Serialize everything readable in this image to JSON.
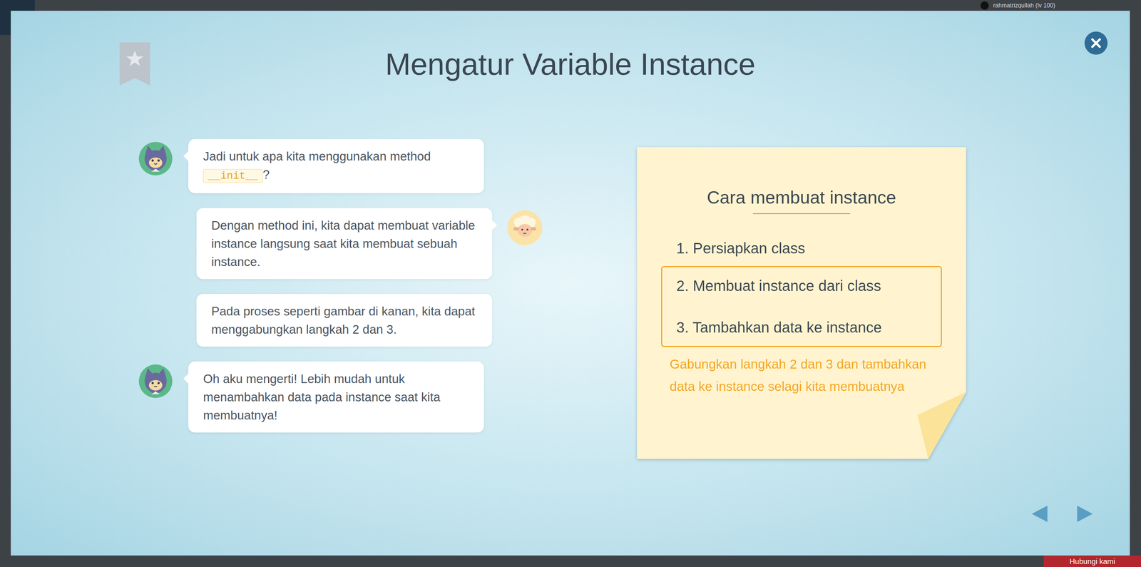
{
  "background": {
    "user": "rahmatrizqullah (lv 100)",
    "help_button": "Hubungi kami"
  },
  "dialog": {
    "title": "Mengatur Variable Instance",
    "bookmarked": false
  },
  "messages": [
    {
      "speaker": "cat",
      "side": "left",
      "show_avatar": true,
      "segments": [
        {
          "text": "Jadi untuk apa kita menggunakan method ",
          "code": false
        },
        {
          "text": "__init__",
          "code": true
        },
        {
          "text": "?",
          "code": false
        }
      ]
    },
    {
      "speaker": "sheep",
      "side": "right",
      "show_avatar": true,
      "segments": [
        {
          "text": "Dengan method ini, kita dapat membuat variable instance langsung saat kita membuat sebuah instance.",
          "code": false
        }
      ]
    },
    {
      "speaker": "sheep",
      "side": "right",
      "show_avatar": false,
      "segments": [
        {
          "text": "Pada proses seperti gambar di kanan, kita dapat menggabungkan langkah 2 dan 3.",
          "code": false
        }
      ]
    },
    {
      "speaker": "cat",
      "side": "left",
      "show_avatar": true,
      "segments": [
        {
          "text": "Oh aku mengerti! Lebih mudah untuk menambahkan data pada instance saat kita membuatnya!",
          "code": false
        }
      ]
    }
  ],
  "note": {
    "title": "Cara membuat instance",
    "steps": [
      {
        "text": "1. Persiapkan class",
        "highlighted": false
      },
      {
        "text": "2. Membuat instance dari class",
        "highlighted": true
      },
      {
        "text": "3. Tambahkan data ke instance",
        "highlighted": true
      }
    ],
    "hint": "Gabungkan langkah 2 dan 3 dan tambahkan data ke instance selagi kita membuatnya"
  },
  "navigation": {
    "prev_enabled": true,
    "next_enabled": true
  }
}
